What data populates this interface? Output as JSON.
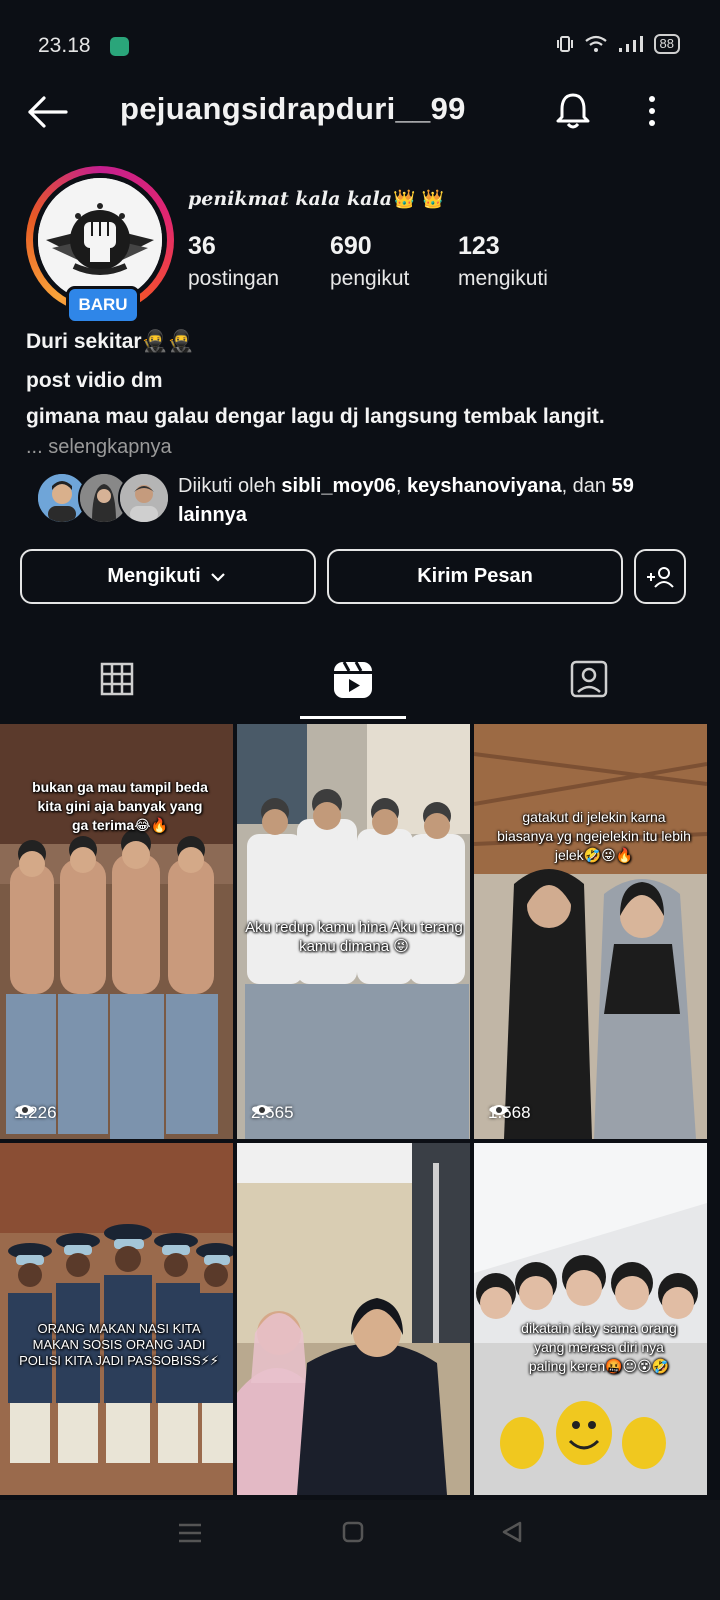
{
  "status_bar": {
    "time": "23.18",
    "battery": "88"
  },
  "header": {
    "username": "pejuangsidrapduri__99"
  },
  "profile": {
    "badge": "BARU",
    "display_name": "penikmat kala kala",
    "display_name_emoji": "👑 👑",
    "stats": [
      {
        "value": "36",
        "label": "postingan"
      },
      {
        "value": "690",
        "label": "pengikut"
      },
      {
        "value": "123",
        "label": "mengikuti"
      }
    ],
    "bio": [
      "Duri sekitar🥷🥷",
      "post vidio dm",
      "gimana mau galau dengar lagu dj langsung tembak langit."
    ],
    "bio_more": "... selengkapnya",
    "followed_by": {
      "prefix": "Diikuti oleh ",
      "user1": "sibli_moy06",
      "sep": ", ",
      "user2": "keyshanoviyana",
      "mid": ", dan ",
      "others": "59 lainnya"
    }
  },
  "buttons": {
    "following": "Mengikuti",
    "message": "Kirim Pesan"
  },
  "tabs": [
    "grid",
    "reels",
    "tagged"
  ],
  "colors": {
    "background": "#0c0f15",
    "badge": "#2f86e8",
    "text": "#f2f2f2"
  },
  "reels": [
    {
      "caption": "bukan ga mau tampil beda kita gini aja banyak yang ga terima😂🔥",
      "views": "1.226"
    },
    {
      "caption": "Aku redup kamu hina Aku terang kamu dimana 😜",
      "views": "2.565"
    },
    {
      "caption": "gatakut di jelekin karna biasanya yg ngejelekin itu lebih jelek🤣😜🔥",
      "views": "1.568"
    },
    {
      "caption": "ORANG MAKAN NASI KITA MAKAN SOSIS ORANG JADI POLISI KITA JADI PASSOBISS⚡⚡",
      "views": ""
    },
    {
      "caption": "",
      "views": ""
    },
    {
      "caption": "dikatain alay sama orang yang merasa diri nya paling keren🤬😐😵🤣",
      "views": ""
    }
  ]
}
